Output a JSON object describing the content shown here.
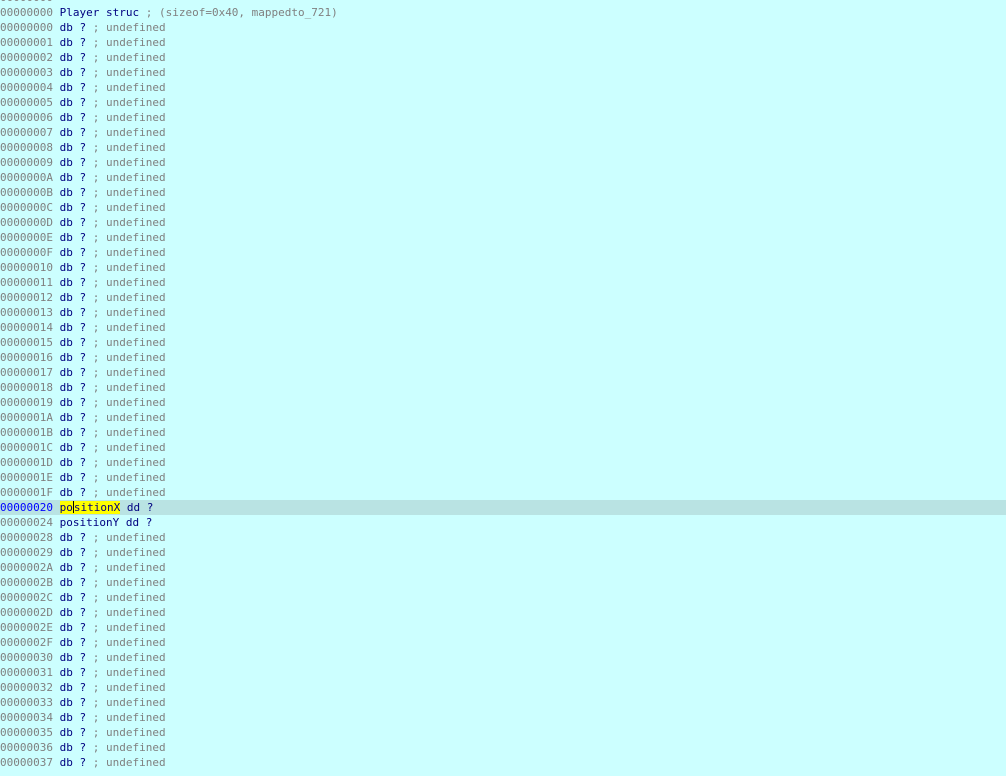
{
  "window": {
    "view": "IDA structure view",
    "cursor_line_index": 35,
    "highlight_color": "#ffff00",
    "background_color": "#ccffff",
    "current_line_color": "#b9e3e3",
    "address_color": "#808080",
    "code_color": "#000080"
  },
  "lines": [
    {
      "addr": "00000000",
      "text": "",
      "comment": ""
    },
    {
      "addr": "00000000",
      "text": "Player struc",
      "comment": "; (sizeof=0x40, mappedto_721)"
    },
    {
      "addr": "00000000",
      "text": "db ?",
      "comment": "; undefined"
    },
    {
      "addr": "00000001",
      "text": "db ?",
      "comment": "; undefined"
    },
    {
      "addr": "00000002",
      "text": "db ?",
      "comment": "; undefined"
    },
    {
      "addr": "00000003",
      "text": "db ?",
      "comment": "; undefined"
    },
    {
      "addr": "00000004",
      "text": "db ?",
      "comment": "; undefined"
    },
    {
      "addr": "00000005",
      "text": "db ?",
      "comment": "; undefined"
    },
    {
      "addr": "00000006",
      "text": "db ?",
      "comment": "; undefined"
    },
    {
      "addr": "00000007",
      "text": "db ?",
      "comment": "; undefined"
    },
    {
      "addr": "00000008",
      "text": "db ?",
      "comment": "; undefined"
    },
    {
      "addr": "00000009",
      "text": "db ?",
      "comment": "; undefined"
    },
    {
      "addr": "0000000A",
      "text": "db ?",
      "comment": "; undefined"
    },
    {
      "addr": "0000000B",
      "text": "db ?",
      "comment": "; undefined"
    },
    {
      "addr": "0000000C",
      "text": "db ?",
      "comment": "; undefined"
    },
    {
      "addr": "0000000D",
      "text": "db ?",
      "comment": "; undefined"
    },
    {
      "addr": "0000000E",
      "text": "db ?",
      "comment": "; undefined"
    },
    {
      "addr": "0000000F",
      "text": "db ?",
      "comment": "; undefined"
    },
    {
      "addr": "00000010",
      "text": "db ?",
      "comment": "; undefined"
    },
    {
      "addr": "00000011",
      "text": "db ?",
      "comment": "; undefined"
    },
    {
      "addr": "00000012",
      "text": "db ?",
      "comment": "; undefined"
    },
    {
      "addr": "00000013",
      "text": "db ?",
      "comment": "; undefined"
    },
    {
      "addr": "00000014",
      "text": "db ?",
      "comment": "; undefined"
    },
    {
      "addr": "00000015",
      "text": "db ?",
      "comment": "; undefined"
    },
    {
      "addr": "00000016",
      "text": "db ?",
      "comment": "; undefined"
    },
    {
      "addr": "00000017",
      "text": "db ?",
      "comment": "; undefined"
    },
    {
      "addr": "00000018",
      "text": "db ?",
      "comment": "; undefined"
    },
    {
      "addr": "00000019",
      "text": "db ?",
      "comment": "; undefined"
    },
    {
      "addr": "0000001A",
      "text": "db ?",
      "comment": "; undefined"
    },
    {
      "addr": "0000001B",
      "text": "db ?",
      "comment": "; undefined"
    },
    {
      "addr": "0000001C",
      "text": "db ?",
      "comment": "; undefined"
    },
    {
      "addr": "0000001D",
      "text": "db ?",
      "comment": "; undefined"
    },
    {
      "addr": "0000001E",
      "text": "db ?",
      "comment": "; undefined"
    },
    {
      "addr": "0000001F",
      "text": "db ?",
      "comment": "; undefined"
    },
    {
      "addr": "00000020",
      "text": "positionX dd ?",
      "comment": "",
      "current": true,
      "highlight": "positionX"
    },
    {
      "addr": "00000024",
      "text": "positionY dd ?",
      "comment": ""
    },
    {
      "addr": "00000028",
      "text": "db ?",
      "comment": "; undefined"
    },
    {
      "addr": "00000029",
      "text": "db ?",
      "comment": "; undefined"
    },
    {
      "addr": "0000002A",
      "text": "db ?",
      "comment": "; undefined"
    },
    {
      "addr": "0000002B",
      "text": "db ?",
      "comment": "; undefined"
    },
    {
      "addr": "0000002C",
      "text": "db ?",
      "comment": "; undefined"
    },
    {
      "addr": "0000002D",
      "text": "db ?",
      "comment": "; undefined"
    },
    {
      "addr": "0000002E",
      "text": "db ?",
      "comment": "; undefined"
    },
    {
      "addr": "0000002F",
      "text": "db ?",
      "comment": "; undefined"
    },
    {
      "addr": "00000030",
      "text": "db ?",
      "comment": "; undefined"
    },
    {
      "addr": "00000031",
      "text": "db ?",
      "comment": "; undefined"
    },
    {
      "addr": "00000032",
      "text": "db ?",
      "comment": "; undefined"
    },
    {
      "addr": "00000033",
      "text": "db ?",
      "comment": "; undefined"
    },
    {
      "addr": "00000034",
      "text": "db ?",
      "comment": "; undefined"
    },
    {
      "addr": "00000035",
      "text": "db ?",
      "comment": "; undefined"
    },
    {
      "addr": "00000036",
      "text": "db ?",
      "comment": "; undefined"
    },
    {
      "addr": "00000037",
      "text": "db ?",
      "comment": "; undefined"
    }
  ]
}
